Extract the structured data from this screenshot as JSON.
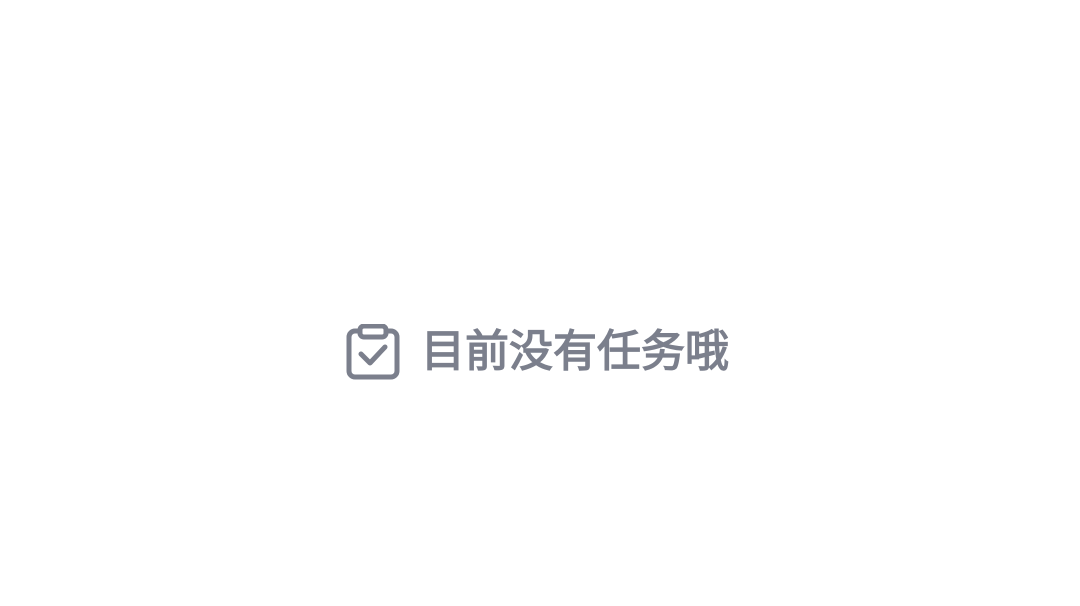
{
  "empty_state": {
    "icon": "clipboard-check-icon",
    "message": "目前没有任务哦",
    "color": "#7B7F8C"
  },
  "background_color": "#FFFFFF"
}
